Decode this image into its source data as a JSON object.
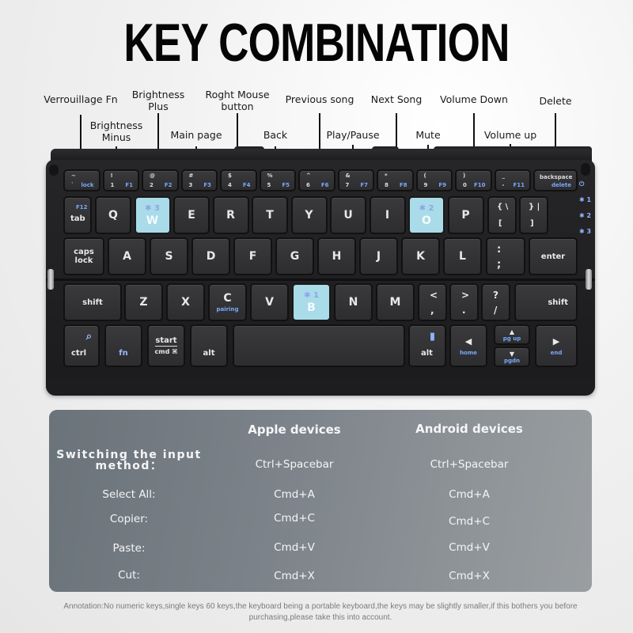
{
  "title": "KEY COMBINATION",
  "callouts": [
    {
      "id": "verrouillage-fn",
      "label": "Verrouillage Fn"
    },
    {
      "id": "brightness-minus",
      "label": "Brightness\nMinus"
    },
    {
      "id": "brightness-plus",
      "label": "Brightness\nPlus"
    },
    {
      "id": "main-page",
      "label": "Main page"
    },
    {
      "id": "right-mouse",
      "label": "Roght Mouse\nbutton"
    },
    {
      "id": "back",
      "label": "Back"
    },
    {
      "id": "previous-song",
      "label": "Previous song"
    },
    {
      "id": "play-pause",
      "label": "Play/Pause"
    },
    {
      "id": "next-song",
      "label": "Next Song"
    },
    {
      "id": "mute",
      "label": "Mute"
    },
    {
      "id": "volume-down",
      "label": "Volume Down"
    },
    {
      "id": "volume-up",
      "label": "Volume up"
    },
    {
      "id": "delete",
      "label": "Delete"
    }
  ],
  "keyboard": {
    "fn_row": [
      {
        "top": "~",
        "bot": "`",
        "fn": "lock"
      },
      {
        "top": "!",
        "bot": "1",
        "fn": "F1"
      },
      {
        "top": "@",
        "bot": "2",
        "fn": "F2"
      },
      {
        "top": "#",
        "bot": "3",
        "fn": "F3"
      },
      {
        "top": "$",
        "bot": "4",
        "fn": "F4"
      },
      {
        "top": "%",
        "bot": "5",
        "fn": "F5"
      },
      {
        "top": "^",
        "bot": "6",
        "fn": "F6"
      },
      {
        "top": "&",
        "bot": "7",
        "fn": "F7"
      },
      {
        "top": "*",
        "bot": "8",
        "fn": "F8"
      },
      {
        "top": "(",
        "bot": "9",
        "fn": "F9"
      },
      {
        "top": ")",
        "bot": "0",
        "fn": "F10"
      },
      {
        "top": "_",
        "bot": "-",
        "fn": "F11"
      }
    ],
    "backspace": {
      "label": "backspace",
      "sub": "delete"
    },
    "row_q": [
      "Q",
      "W",
      "E",
      "R",
      "T",
      "Y",
      "U",
      "I",
      "O",
      "P"
    ],
    "row_q_extra": [
      {
        "top": "{ \\",
        "bot": "["
      },
      {
        "top": "} |",
        "bot": "]"
      }
    ],
    "tab": {
      "label": "tab",
      "sub": "F12"
    },
    "row_a": [
      "A",
      "S",
      "D",
      "F",
      "G",
      "H",
      "J",
      "K",
      "L"
    ],
    "semicolon": {
      "top": ":",
      "bot": ";"
    },
    "caps": "caps\nlock",
    "enter": "enter",
    "row_z": [
      "Z",
      "X",
      "C",
      "V",
      "B",
      "N",
      "M"
    ],
    "row_z_extra": [
      {
        "top": "<",
        "bot": ","
      },
      {
        "top": ">",
        "bot": "."
      },
      {
        "top": "?",
        "bot": "/"
      }
    ],
    "c_sub": "pairing",
    "shift": "shift",
    "ctrl": "ctrl",
    "fn": "fn",
    "start_top": "start",
    "start_bot": "cmd ⌘",
    "alt": "alt",
    "home": "home",
    "pgup": "pg up",
    "pgdn": "pgdn",
    "end": "end",
    "bt_keys": [
      {
        "key": "W",
        "badge": "✱ 3"
      },
      {
        "key": "O",
        "badge": "✱ 2"
      },
      {
        "key": "B",
        "badge": "✱ 1"
      }
    ],
    "indicators": [
      "⏻",
      "✱ 1",
      "✱ 2",
      "✱ 3"
    ]
  },
  "table": {
    "headers": [
      "",
      "Apple devices",
      "Android devices"
    ],
    "rows": [
      {
        "label": "Switching the input\nmethod：",
        "apple": "Ctrl+Spacebar",
        "android": "Ctrl+Spacebar"
      },
      {
        "label": "Select All:",
        "apple": "Cmd+A",
        "android": "Cmd+A"
      },
      {
        "label": "Copier:",
        "apple": "Cmd+C",
        "android": "Cmd+C"
      },
      {
        "label": "Paste:",
        "apple": "Cmd+V",
        "android": "Cmd+V"
      },
      {
        "label": "Cut:",
        "apple": "Cmd+X",
        "android": "Cmd+X"
      }
    ]
  },
  "annotation": "Annotation:No numeric keys,single keys 60 keys,the keyboard being a portable keyboard,the keys may be slightly smaller,if this bothers you before purchasing,please take this into account.",
  "colors": {
    "highlight_key": "#a9dbe8",
    "bluetooth_glyph": "#8fa4ea",
    "table_panel": "#7d848b"
  }
}
